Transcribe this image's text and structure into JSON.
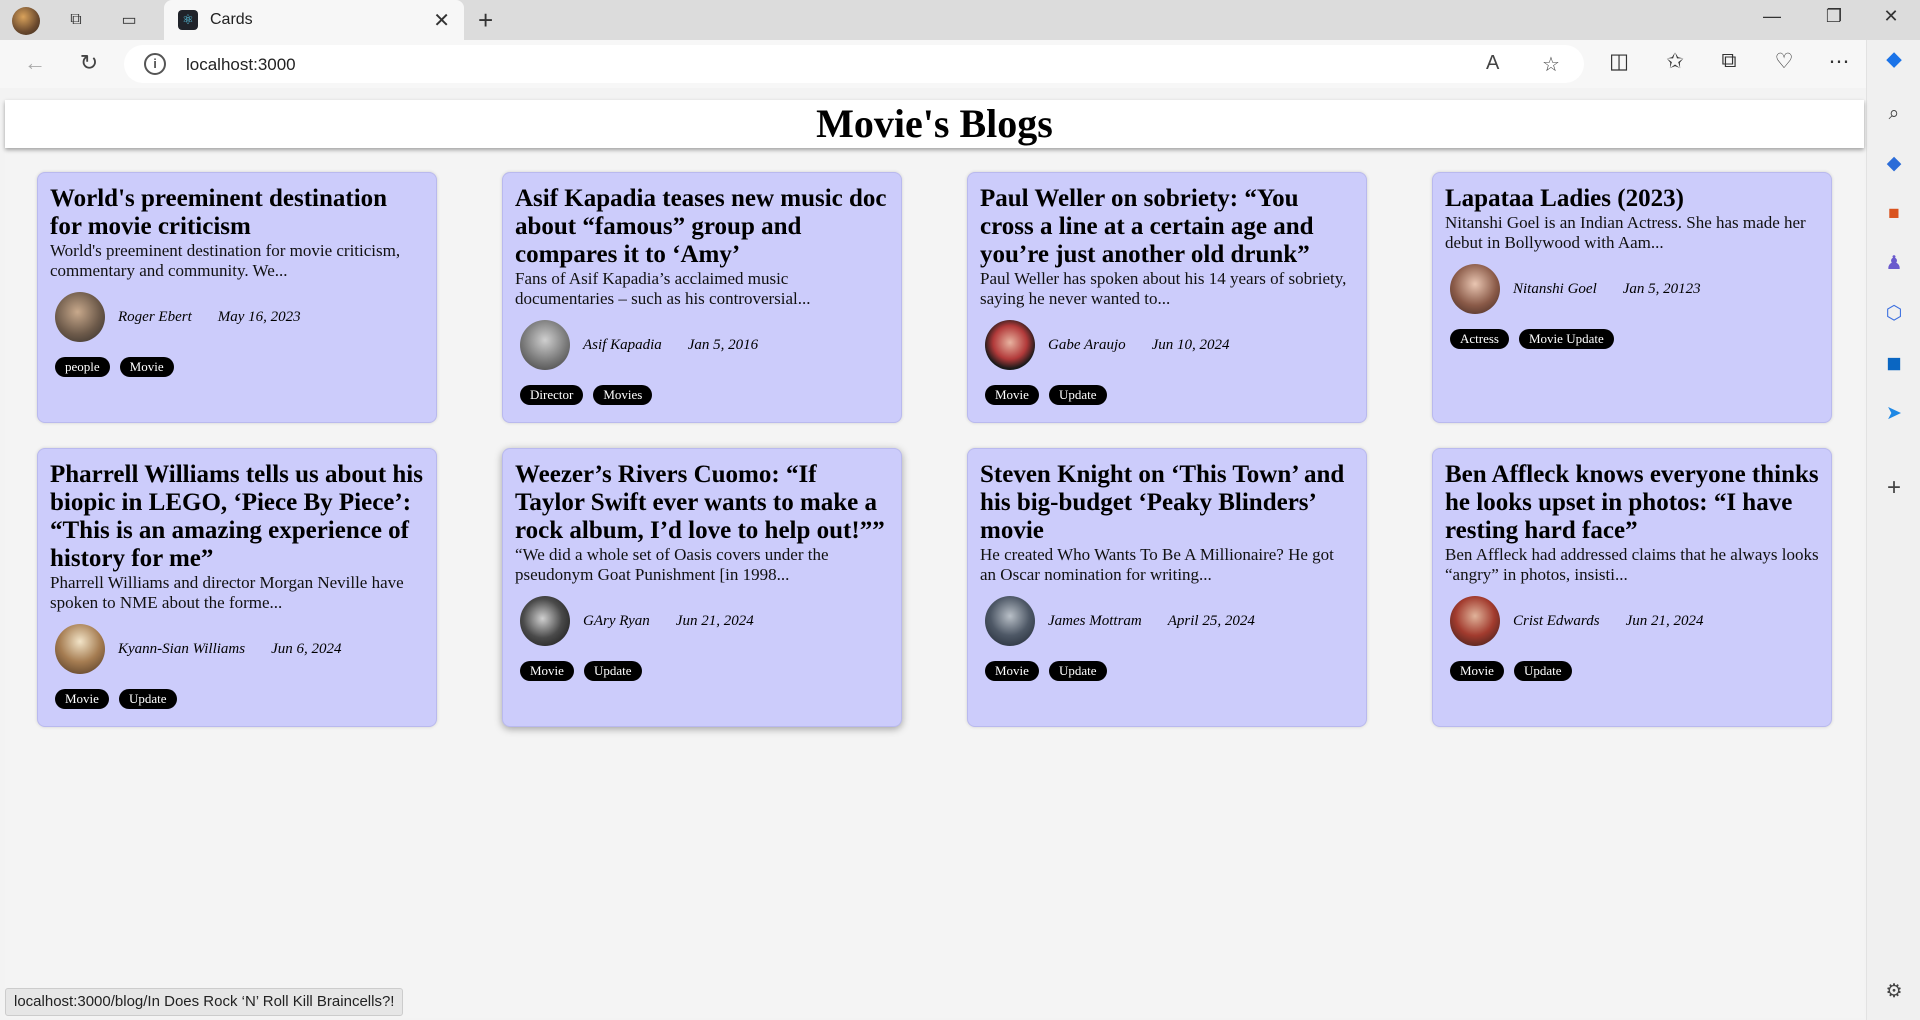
{
  "browser": {
    "tab_title": "Cards",
    "url": "localhost:3000",
    "status_url": "localhost:3000/blog/In Does Rock ‘N’ Roll Kill Braincells?!"
  },
  "page": {
    "title": "Movie's Blogs"
  },
  "cards": [
    {
      "title": "World's preeminent destination for movie criticism",
      "excerpt": "World's preeminent destination for movie criticism, commentary and community. We...",
      "author": "Roger Ebert",
      "date": "May 16, 2023",
      "tags": [
        "people",
        "Movie"
      ]
    },
    {
      "title": "Asif Kapadia teases new music doc about “famous” group and compares it to ‘Amy’",
      "excerpt": "Fans of Asif Kapadia’s acclaimed music documentaries – such as his controversial...",
      "author": "Asif Kapadia",
      "date": "Jan 5, 2016",
      "tags": [
        "Director",
        "Movies"
      ]
    },
    {
      "title": "Paul Weller on sobriety: “You cross a line at a certain age and you’re just another old drunk”",
      "excerpt": "Paul Weller has spoken about his 14 years of sobriety, saying he never wanted to...",
      "author": "Gabe Araujo",
      "date": "Jun 10, 2024",
      "tags": [
        "Movie",
        "Update"
      ]
    },
    {
      "title": "Lapataa Ladies (2023)",
      "excerpt": "Nitanshi Goel is an Indian Actress. She has made her debut in Bollywood with Aam...",
      "author": "Nitanshi Goel",
      "date": "Jan 5, 20123",
      "tags": [
        "Actress",
        "Movie Update"
      ]
    },
    {
      "title": "Pharrell Williams tells us about his biopic in LEGO, ‘Piece By Piece’: “This is an amazing experience of history for me”",
      "excerpt": "Pharrell Williams and director Morgan Neville have spoken to NME about the forme...",
      "author": "Kyann-Sian Williams",
      "date": "Jun 6, 2024",
      "tags": [
        "Movie",
        "Update"
      ]
    },
    {
      "title": "Weezer’s Rivers Cuomo: “If Taylor Swift ever wants to make a rock album, I’d love to help out!””",
      "excerpt": "“We did a whole set of Oasis covers under the pseudonym Goat Punishment [in 1998...",
      "author": "GAry Ryan",
      "date": "Jun 21, 2024",
      "tags": [
        "Movie",
        "Update"
      ]
    },
    {
      "title": "Steven Knight on ‘This Town’ and his big-budget ‘Peaky Blinders’ movie",
      "excerpt": "He created Who Wants To Be A Millionaire? He got an Oscar nomination for writing...",
      "author": "James Mottram",
      "date": "April 25, 2024",
      "tags": [
        "Movie",
        "Update"
      ]
    },
    {
      "title": "Ben Affleck knows everyone thinks he looks upset in photos: “I have resting hard face”",
      "excerpt": "Ben Affleck had addressed claims that he always looks “angry” in photos, insisti...",
      "author": "Crist Edwards",
      "date": "Jun 21, 2024",
      "tags": [
        "Movie",
        "Update"
      ]
    }
  ]
}
